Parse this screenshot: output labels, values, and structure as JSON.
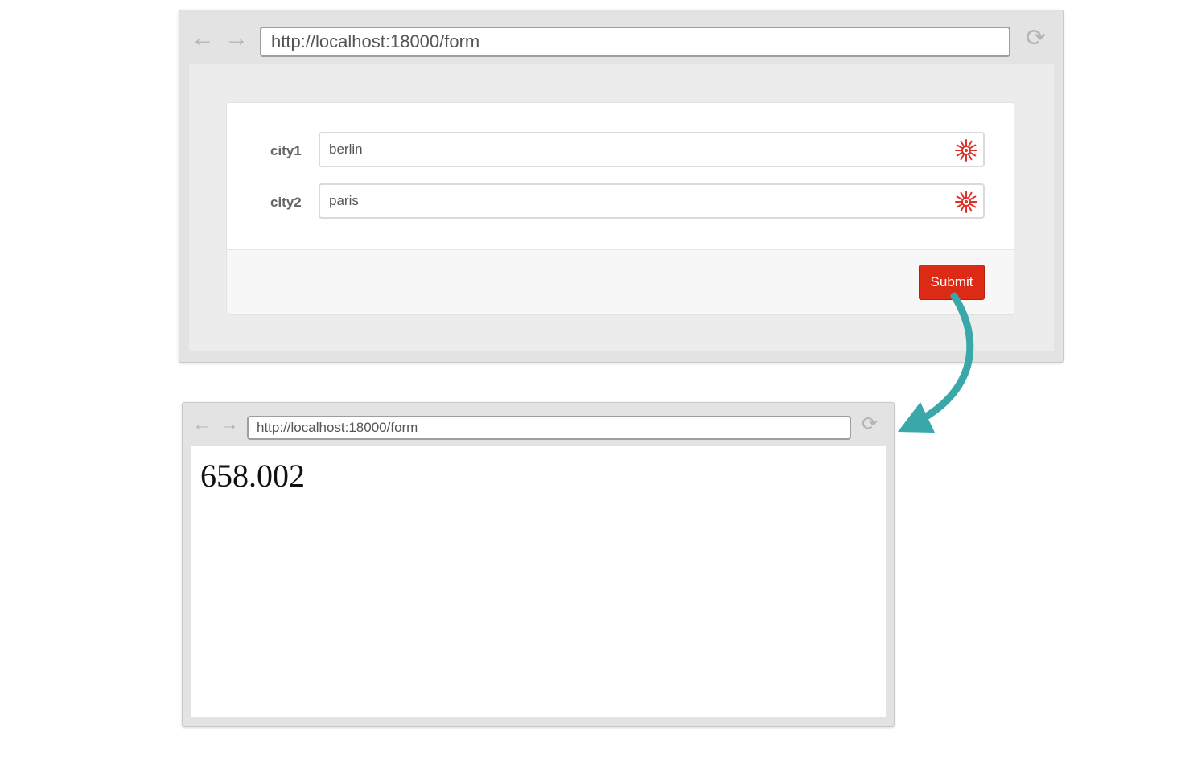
{
  "browser_top": {
    "url": "http://localhost:18000/form",
    "form": {
      "fields": [
        {
          "label": "city1",
          "value": "berlin"
        },
        {
          "label": "city2",
          "value": "paris"
        }
      ],
      "submit_label": "Submit"
    }
  },
  "browser_bottom": {
    "url": "http://localhost:18000/form",
    "result": "658.002"
  },
  "icons": {
    "back": "back-arrow-icon",
    "forward": "forward-arrow-icon",
    "reload": "reload-icon",
    "field": "snowflake-icon",
    "flow": "curved-arrow-icon"
  },
  "colors": {
    "submit": "#dc2a14",
    "field_icon": "#e0302a",
    "flow_arrow": "#3aa8a8"
  }
}
